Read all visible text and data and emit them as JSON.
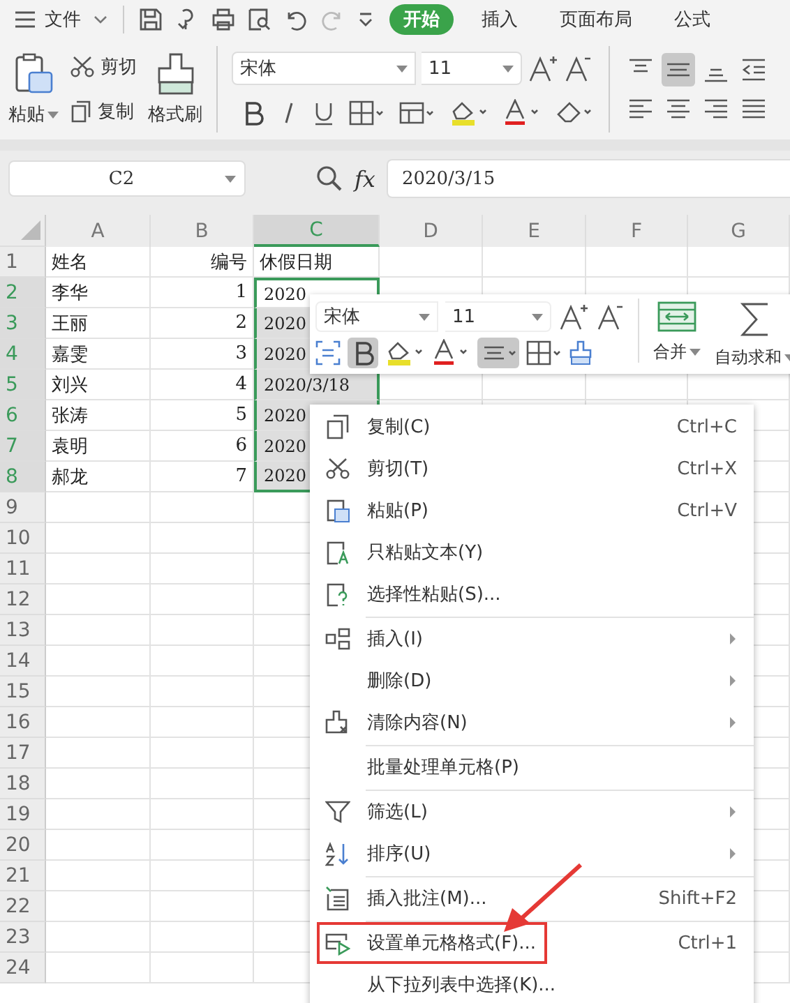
{
  "quick_bar": {
    "file_menu": "文件",
    "tabs": [
      {
        "label": "开始",
        "selected": true
      },
      {
        "label": "插入",
        "selected": false
      },
      {
        "label": "页面布局",
        "selected": false
      },
      {
        "label": "公式",
        "selected": false
      }
    ]
  },
  "ribbon": {
    "paste": "粘贴",
    "cut": "剪切",
    "copy": "复制",
    "format_painter": "格式刷",
    "font": "宋体",
    "size": "11",
    "center_align_on": true
  },
  "formula_bar": {
    "name_box": "C2",
    "fx": "fx",
    "value": "2020/3/15"
  },
  "sheet": {
    "columns": [
      {
        "label": "A",
        "selected": false
      },
      {
        "label": "B",
        "selected": false
      },
      {
        "label": "C",
        "selected": true
      },
      {
        "label": "D",
        "selected": false
      },
      {
        "label": "E",
        "selected": false
      },
      {
        "label": "F",
        "selected": false
      },
      {
        "label": "G",
        "selected": false
      }
    ],
    "extra_rows": [
      "9",
      "10",
      "11",
      "12",
      "13",
      "14",
      "15",
      "16",
      "17",
      "18",
      "19",
      "20",
      "21",
      "22",
      "23",
      "24"
    ],
    "rows": [
      {
        "number": "1",
        "selected": false,
        "cells": [
          "姓名",
          "编号",
          "休假日期"
        ]
      },
      {
        "number": "2",
        "selected": true,
        "cells": [
          "李华",
          "1",
          "2020"
        ]
      },
      {
        "number": "3",
        "selected": true,
        "cells": [
          "王丽",
          "2",
          "2020"
        ]
      },
      {
        "number": "4",
        "selected": true,
        "cells": [
          "嘉雯",
          "3",
          "2020"
        ]
      },
      {
        "number": "5",
        "selected": true,
        "cells": [
          "刘兴",
          "4",
          "2020/3/18"
        ]
      },
      {
        "number": "6",
        "selected": true,
        "cells": [
          "张涛",
          "5",
          "2020"
        ]
      },
      {
        "number": "7",
        "selected": true,
        "cells": [
          "袁明",
          "6",
          "2020"
        ]
      },
      {
        "number": "8",
        "selected": true,
        "cells": [
          "郝龙",
          "7",
          "2020"
        ]
      }
    ]
  },
  "mini_toolbar": {
    "font": "宋体",
    "size": "11",
    "bold_on": true,
    "center_align_on": true,
    "merge": "合并",
    "autosum": "自动求和"
  },
  "context_menu": [
    {
      "label": "复制(C)",
      "shortcut": "Ctrl+C",
      "submenu": false,
      "separator_after": false,
      "highlighted": false
    },
    {
      "label": "剪切(T)",
      "shortcut": "Ctrl+X",
      "submenu": false,
      "separator_after": false,
      "highlighted": false
    },
    {
      "label": "粘贴(P)",
      "shortcut": "Ctrl+V",
      "submenu": false,
      "separator_after": false,
      "highlighted": false
    },
    {
      "label": "只粘贴文本(Y)",
      "submenu": false,
      "separator_after": false,
      "highlighted": false
    },
    {
      "label": "选择性粘贴(S)...",
      "submenu": false,
      "separator_after": true,
      "highlighted": false
    },
    {
      "label": "插入(I)",
      "submenu": true,
      "separator_after": false,
      "highlighted": false
    },
    {
      "label": "删除(D)",
      "submenu": true,
      "separator_after": false,
      "highlighted": false
    },
    {
      "label": "清除内容(N)",
      "submenu": true,
      "separator_after": true,
      "highlighted": false
    },
    {
      "label": "批量处理单元格(P)",
      "submenu": false,
      "separator_after": true,
      "highlighted": false
    },
    {
      "label": "筛选(L)",
      "submenu": true,
      "separator_after": false,
      "highlighted": false
    },
    {
      "label": "排序(U)",
      "submenu": true,
      "separator_after": true,
      "highlighted": false
    },
    {
      "label": "插入批注(M)...",
      "shortcut": "Shift+F2",
      "submenu": false,
      "separator_after": true,
      "highlighted": false
    },
    {
      "label": "设置单元格格式(F)...",
      "shortcut": "Ctrl+1",
      "submenu": false,
      "separator_after": false,
      "highlighted": true
    },
    {
      "label": "从下拉列表中选择(K)...",
      "submenu": false,
      "separator_after": false,
      "highlighted": false
    }
  ]
}
